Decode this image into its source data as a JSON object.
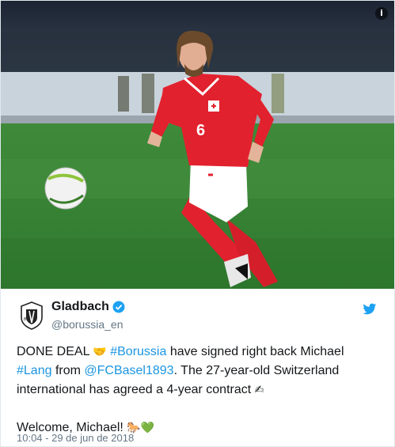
{
  "photo": {
    "info_icon": "info-icon",
    "shirt_number": "6"
  },
  "account": {
    "name": "Gladbach",
    "handle": "@borussia_en",
    "verified_icon": "verified-badge-icon",
    "platform_icon": "twitter-bird-icon"
  },
  "tweet": {
    "line1_prefix": "DONE DEAL ",
    "emoji_handshake": "🤝",
    "hashtag_borussia": "#Borussia",
    "line1_suffix": " have signed right back Michael",
    "hashtag_lang": "#Lang",
    "from_text": " from ",
    "mention_basel": "@FCBasel1893",
    "line2_suffix": ". The 27-year-old Switzerland",
    "line3": "international has agreed a 4-year contract ",
    "emoji_sign": "✍",
    "welcome": "Welcome, Michael! ",
    "emoji_horse": "🐎",
    "emoji_heart": "💚",
    "timestamp": "10:04 - 29 de jun de 2018"
  },
  "colors": {
    "link": "#1b95e0",
    "text": "#14171a",
    "muted": "#657786",
    "verified": "#1da1f2"
  }
}
